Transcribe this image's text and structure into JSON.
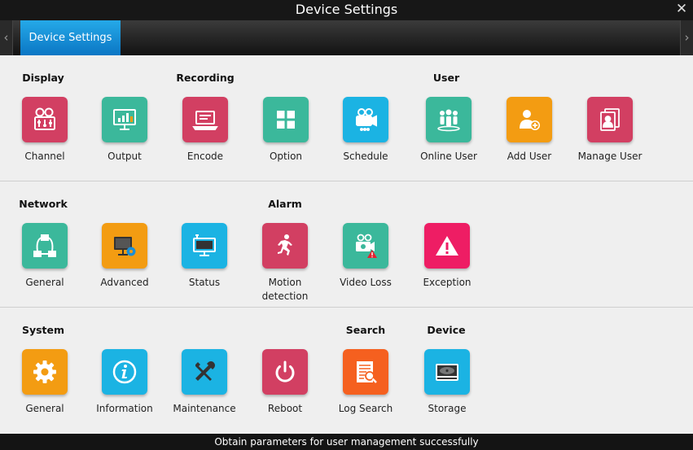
{
  "window": {
    "title": "Device Settings",
    "close_glyph": "✕"
  },
  "nav": {
    "left_arrow": "‹",
    "right_arrow": "›"
  },
  "tabs": [
    {
      "label": "Device Settings",
      "active": true
    }
  ],
  "categories": {
    "display": "Display",
    "recording": "Recording",
    "user": "User",
    "network": "Network",
    "alarm": "Alarm",
    "system": "System",
    "search": "Search",
    "device": "Device"
  },
  "items": {
    "channel": {
      "label": "Channel",
      "icon": "camera-sliders-icon",
      "color": "#d23f62"
    },
    "output": {
      "label": "Output",
      "icon": "monitor-chart-icon",
      "color": "#3bb89b"
    },
    "encode": {
      "label": "Encode",
      "icon": "laptop-icon",
      "color": "#d23f62"
    },
    "option": {
      "label": "Option",
      "icon": "grid-icon",
      "color": "#3bb89b"
    },
    "schedule": {
      "label": "Schedule",
      "icon": "video-camera-icon",
      "color": "#1bb3e3"
    },
    "online_user": {
      "label": "Online User",
      "icon": "users-group-icon",
      "color": "#3bb89b"
    },
    "add_user": {
      "label": "Add User",
      "icon": "add-user-icon",
      "color": "#f39c12"
    },
    "manage_user": {
      "label": "Manage User",
      "icon": "user-cards-icon",
      "color": "#d23f62"
    },
    "net_general": {
      "label": "General",
      "icon": "network-nodes-icon",
      "color": "#3bb89b"
    },
    "advanced": {
      "label": "Advanced",
      "icon": "monitor-gear-icon",
      "color": "#f39c12"
    },
    "status": {
      "label": "Status",
      "icon": "monitor-antenna-icon",
      "color": "#1bb3e3"
    },
    "motion": {
      "label": "Motion\ndetection",
      "icon": "running-person-icon",
      "color": "#d23f62"
    },
    "video_loss": {
      "label": "Video Loss",
      "icon": "camera-warning-icon",
      "color": "#3bb89b"
    },
    "exception": {
      "label": "Exception",
      "icon": "warning-triangle-icon",
      "color": "#ee1d64"
    },
    "sys_general": {
      "label": "General",
      "icon": "gear-icon",
      "color": "#f39c12"
    },
    "information": {
      "label": "Information",
      "icon": "info-icon",
      "color": "#1bb3e3"
    },
    "maintenance": {
      "label": "Maintenance",
      "icon": "tools-icon",
      "color": "#1bb3e3"
    },
    "reboot": {
      "label": "Reboot",
      "icon": "power-icon",
      "color": "#d23f62"
    },
    "log_search": {
      "label": "Log Search",
      "icon": "log-magnifier-icon",
      "color": "#f5601f"
    },
    "storage": {
      "label": "Storage",
      "icon": "hard-disk-icon",
      "color": "#1bb3e3"
    }
  },
  "status_message": "Obtain parameters for user management successfully"
}
